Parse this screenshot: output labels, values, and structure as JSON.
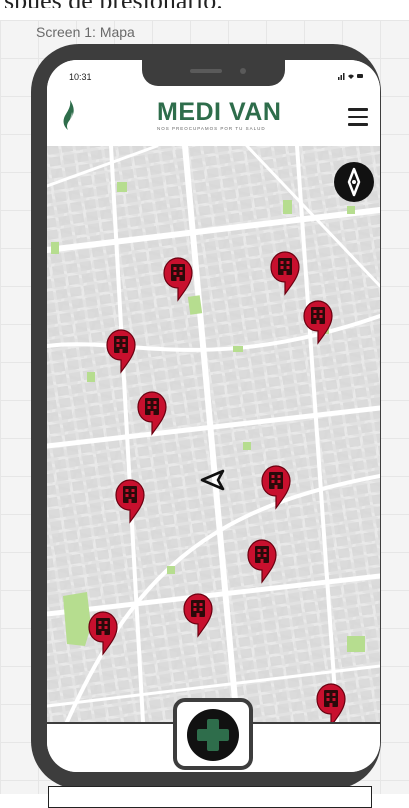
{
  "caption": "spués de presionarlo.",
  "screen_label": "Screen 1: Mapa",
  "status_bar": {
    "time": "10:31",
    "icons": "signal-wifi-battery"
  },
  "header": {
    "brand": "MEDI VAN",
    "tagline": "NOS PREOCUPAMOS POR TU SALUD",
    "logo_icon": "flame-logo-icon",
    "menu_icon": "hamburger-menu-icon"
  },
  "map": {
    "compass_icon": "compass-icon",
    "user_location_icon": "navigation-arrow-icon",
    "marker_icon": "hospital-pin-icon",
    "marker_color": "#c8102e",
    "marker_count": 13
  },
  "bottom_bar": {
    "fab_icon": "add-plus-icon",
    "fab_accent": "#2e6d4b"
  },
  "colors": {
    "phone_frame": "#3d3d3d",
    "map_background": "#dcdcdc",
    "park": "#b6dd8f"
  }
}
